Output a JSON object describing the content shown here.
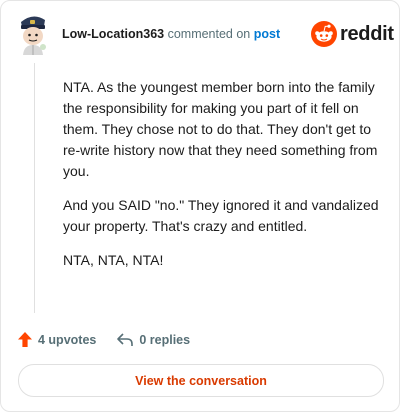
{
  "comment": {
    "author": "Low-Location363",
    "action": "commented on",
    "target": "post",
    "paragraphs": [
      "NTA. As the youngest member born into the family the responsibility for making you part of it fell on them. They chose not to do that. They don't get to re-write history now that they need something from you.",
      "And you SAID \"no.\" They ignored it and vandalized your property. That's crazy and entitled.",
      "NTA, NTA, NTA!"
    ]
  },
  "brand": {
    "name": "reddit",
    "color": "#ff4500"
  },
  "stats": {
    "upvotes": "4 upvotes",
    "replies": "0 replies",
    "upvote_color": "#ff4500"
  },
  "cta": {
    "label": "View the conversation",
    "color": "#d93a00"
  },
  "icons": {
    "avatar": "avatar-icon",
    "brand": "reddit-snoo-icon",
    "upvote": "upvote-arrow-icon",
    "reply": "reply-arrow-icon"
  }
}
